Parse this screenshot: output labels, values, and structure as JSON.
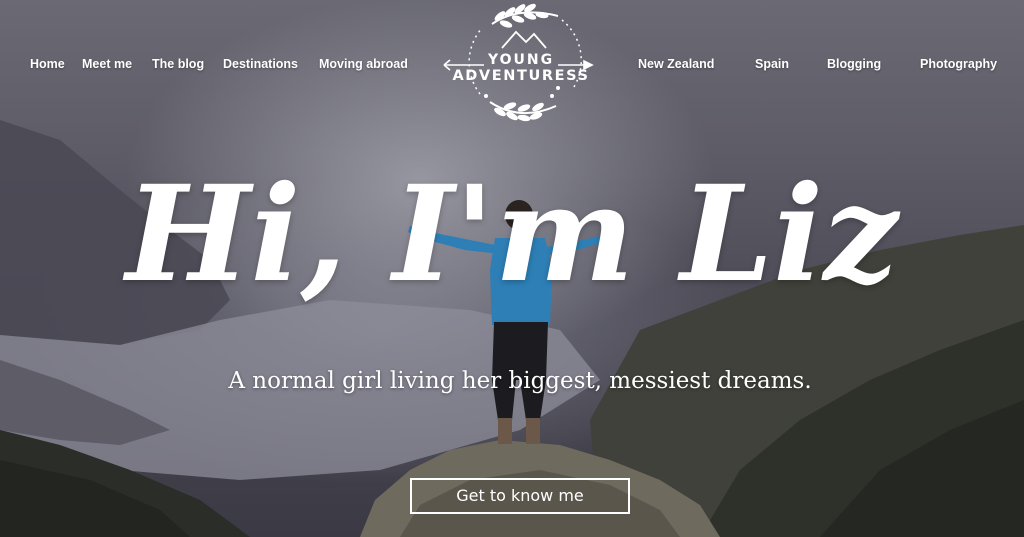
{
  "nav": {
    "left": [
      "Home",
      "Meet me",
      "The blog",
      "Destinations",
      "Moving abroad"
    ],
    "right": [
      "New Zealand",
      "Spain",
      "Blogging",
      "Photography"
    ]
  },
  "logo": {
    "line1": "YOUNG",
    "line2": "ADVENTURESS"
  },
  "hero": {
    "headline": "Hi, I'm Liz",
    "tagline": "A normal girl living her biggest, messiest dreams.",
    "cta_label": "Get to know me"
  },
  "colors": {
    "text": "#ffffff",
    "sky": "#5c5b66",
    "lake": "#8a8a98",
    "mountain_dark": "#2c2e2a",
    "jacket": "#2d7fb6"
  },
  "icons": [
    "laurel-icon",
    "arrow-icon",
    "mountain-icon"
  ]
}
